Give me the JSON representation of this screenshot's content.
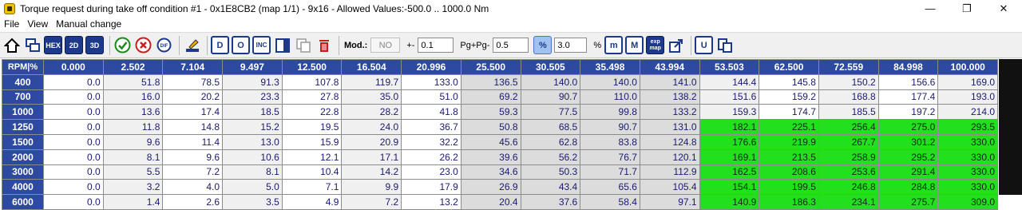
{
  "window": {
    "title": "Torque request during take off condition #1 - 0x1E8CB2 (map 1/1) - 9x16 - Allowed Values:-500.0 .. 1000.0 Nm",
    "minimize": "—",
    "maximize": "❐",
    "close": "✕"
  },
  "menu": [
    "File",
    "View",
    "Manual change"
  ],
  "toolbar": {
    "mod_label": "Mod.:",
    "mod_value": "NO",
    "pm_label": "+-",
    "pm_value": "0.1",
    "pgpg_label": "Pg+Pg-",
    "pgpg_value": "0.5",
    "percent_btn": "%",
    "percent_value": "3.0",
    "percent_unit": "%",
    "buttons": {
      "hex": "HEX",
      "d2": "2D",
      "d3": "3D",
      "dif": "DIF",
      "d": "D",
      "o": "O",
      "inc": "INC",
      "m_small": "m",
      "m_big": "M",
      "exp_map": "exp map",
      "u": "U"
    }
  },
  "table": {
    "corner": "RPM|%",
    "columns": [
      "0.000",
      "2.502",
      "7.104",
      "9.497",
      "12.500",
      "16.504",
      "20.996",
      "25.500",
      "30.505",
      "35.498",
      "43.994",
      "53.503",
      "62.500",
      "72.559",
      "84.998",
      "100.000"
    ],
    "rows": [
      {
        "rpm": "400",
        "values": [
          "0.0",
          "51.8",
          "78.5",
          "91.3",
          "107.8",
          "119.7",
          "133.0",
          "136.5",
          "140.0",
          "140.0",
          "141.0",
          "144.4",
          "145.8",
          "150.2",
          "156.6",
          "169.0"
        ]
      },
      {
        "rpm": "700",
        "values": [
          "0.0",
          "16.0",
          "20.2",
          "23.3",
          "27.8",
          "35.0",
          "51.0",
          "69.2",
          "90.7",
          "110.0",
          "138.2",
          "151.6",
          "159.2",
          "168.8",
          "177.4",
          "193.0"
        ]
      },
      {
        "rpm": "1000",
        "values": [
          "0.0",
          "13.6",
          "17.4",
          "18.5",
          "22.8",
          "28.2",
          "41.8",
          "59.3",
          "77.5",
          "99.8",
          "133.2",
          "159.3",
          "174.7",
          "185.5",
          "197.2",
          "214.0"
        ]
      },
      {
        "rpm": "1250",
        "values": [
          "0.0",
          "11.8",
          "14.8",
          "15.2",
          "19.5",
          "24.0",
          "36.7",
          "50.8",
          "68.5",
          "90.7",
          "131.0",
          "182.1",
          "225.1",
          "256.4",
          "275.0",
          "293.5"
        ]
      },
      {
        "rpm": "1500",
        "values": [
          "0.0",
          "9.6",
          "11.4",
          "13.0",
          "15.9",
          "20.9",
          "32.2",
          "45.6",
          "62.8",
          "83.8",
          "124.8",
          "176.6",
          "219.9",
          "267.7",
          "301.2",
          "330.0"
        ]
      },
      {
        "rpm": "2000",
        "values": [
          "0.0",
          "8.1",
          "9.6",
          "10.6",
          "12.1",
          "17.1",
          "26.2",
          "39.6",
          "56.2",
          "76.7",
          "120.1",
          "169.1",
          "213.5",
          "258.9",
          "295.2",
          "330.0"
        ]
      },
      {
        "rpm": "3000",
        "values": [
          "0.0",
          "5.5",
          "7.2",
          "8.1",
          "10.4",
          "14.2",
          "23.0",
          "34.6",
          "50.3",
          "71.7",
          "112.9",
          "162.5",
          "208.6",
          "253.6",
          "291.4",
          "330.0"
        ]
      },
      {
        "rpm": "4000",
        "values": [
          "0.0",
          "3.2",
          "4.0",
          "5.0",
          "7.1",
          "9.9",
          "17.9",
          "26.9",
          "43.4",
          "65.6",
          "105.4",
          "154.1",
          "199.5",
          "246.8",
          "284.8",
          "330.0"
        ]
      },
      {
        "rpm": "6000",
        "values": [
          "0.0",
          "1.4",
          "2.6",
          "3.5",
          "4.9",
          "7.2",
          "13.2",
          "20.4",
          "37.6",
          "58.4",
          "97.1",
          "140.9",
          "186.3",
          "234.1",
          "275.7",
          "309.0"
        ]
      }
    ],
    "green_rows_from": 3,
    "green_cols_from": 11,
    "colors": {
      "header": "#2d4aa0",
      "green": "#22e01e",
      "cell_text": "#1a1a6e"
    }
  }
}
